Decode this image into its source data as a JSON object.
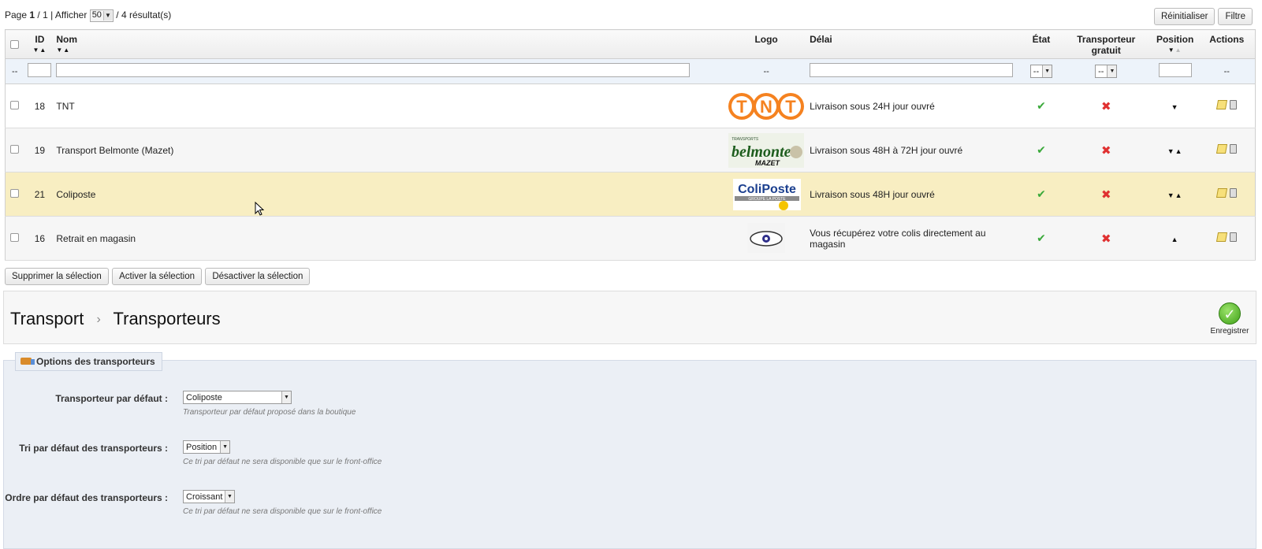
{
  "pagination": {
    "page_label": "Page",
    "page_current": "1",
    "page_total": "/ 1 | Afficher",
    "per_page": "50",
    "results": "/ 4 résultat(s)"
  },
  "top_buttons": {
    "reset": "Réinitialiser",
    "filter": "Filtre"
  },
  "columns": {
    "id": "ID",
    "nom": "Nom",
    "logo": "Logo",
    "delai": "Délai",
    "etat": "État",
    "gratuit": "Transporteur gratuit",
    "position": "Position",
    "actions": "Actions"
  },
  "filters": {
    "leading": "--",
    "logo": "--",
    "etat": "--",
    "gratuit": "--",
    "actions": "--"
  },
  "rows": [
    {
      "id": "18",
      "nom": "TNT",
      "logo_text": "TNT",
      "delai": "Livraison sous 24H jour ouvré",
      "position": "▼"
    },
    {
      "id": "19",
      "nom": "Transport Belmonte (Mazet)",
      "logo_text": "belmonte",
      "logo_sub": "MAZET",
      "delai": "Livraison sous 48H à 72H jour ouvré",
      "position": "▼▲"
    },
    {
      "id": "21",
      "nom": "Coliposte",
      "logo_text": "ColiPoste",
      "delai": "Livraison sous 48H jour ouvré",
      "position": "▼▲"
    },
    {
      "id": "16",
      "nom": "Retrait en magasin",
      "logo_text": "",
      "delai": "Vous récupérez votre colis directement au magasin",
      "position": "▲"
    }
  ],
  "bulk_actions": {
    "delete": "Supprimer la sélection",
    "enable": "Activer la sélection",
    "disable": "Désactiver la sélection"
  },
  "breadcrumb": {
    "parent": "Transport",
    "separator": "›",
    "current": "Transporteurs"
  },
  "save_label": "Enregistrer",
  "options": {
    "legend": "Options des transporteurs",
    "default_carrier": {
      "label": "Transporteur par défaut :",
      "value": "Coliposte",
      "hint": "Transporteur par défaut proposé dans la boutique"
    },
    "default_sort": {
      "label": "Tri par défaut des transporteurs :",
      "value": "Position",
      "hint": "Ce tri par défaut ne sera disponible que sur le front-office"
    },
    "default_order": {
      "label": "Ordre par défaut des transporteurs :",
      "value": "Croissant",
      "hint": "Ce tri par défaut ne sera disponible que sur le front-office"
    }
  },
  "icons": {
    "sort": "sort-arrows-icon",
    "check": "check-icon",
    "cross": "cross-icon",
    "edit": "edit-icon",
    "delete": "trash-icon",
    "save": "save-check-icon",
    "truck": "truck-icon"
  },
  "colors": {
    "highlight_row": "#f8eec2",
    "enabled": "#3aa93a",
    "disabled": "#e03131",
    "fieldset_bg": "#ebeff5"
  }
}
